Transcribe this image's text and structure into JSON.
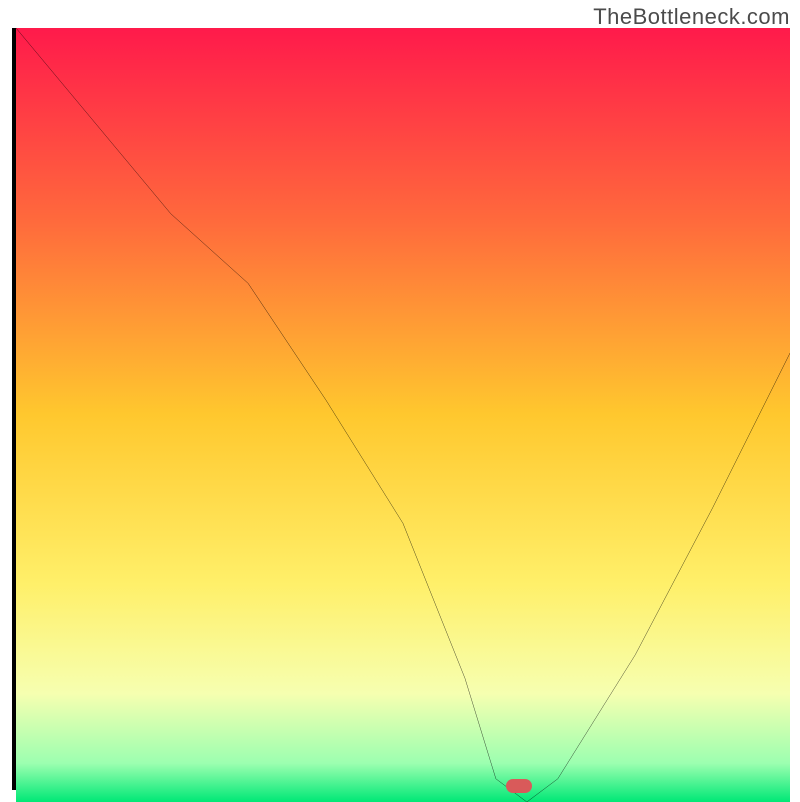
{
  "attribution": "TheBottleneck.com",
  "chart_data": {
    "type": "line",
    "title": "",
    "xlabel": "",
    "ylabel": "",
    "xlim": [
      0,
      100
    ],
    "ylim": [
      0,
      100
    ],
    "series": [
      {
        "name": "bottleneck-curve",
        "x": [
          0,
          10,
          20,
          30,
          40,
          50,
          58,
          62,
          66,
          70,
          80,
          90,
          100
        ],
        "y": [
          100,
          88,
          76,
          67,
          52,
          36,
          16,
          3,
          0,
          3,
          19,
          38,
          58
        ]
      }
    ],
    "marker": {
      "x": 65,
      "y": 0,
      "name": "optimal-point"
    },
    "background_gradient_stops": [
      {
        "pct": 0,
        "color": "#ff1a4b"
      },
      {
        "pct": 25,
        "color": "#ff6a3c"
      },
      {
        "pct": 50,
        "color": "#ffc82e"
      },
      {
        "pct": 72,
        "color": "#fff06a"
      },
      {
        "pct": 86,
        "color": "#f6ffb0"
      },
      {
        "pct": 95,
        "color": "#9cffb0"
      },
      {
        "pct": 100,
        "color": "#00e876"
      }
    ]
  }
}
